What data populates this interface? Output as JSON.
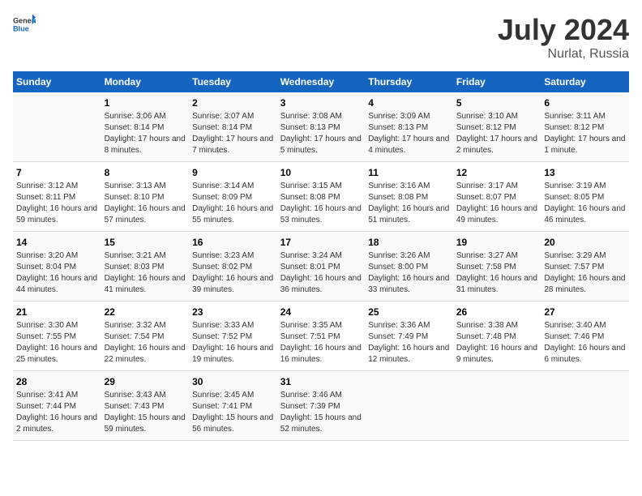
{
  "header": {
    "logo_general": "General",
    "logo_blue": "Blue",
    "title": "July 2024",
    "subtitle": "Nurlat, Russia"
  },
  "calendar": {
    "days_of_week": [
      "Sunday",
      "Monday",
      "Tuesday",
      "Wednesday",
      "Thursday",
      "Friday",
      "Saturday"
    ],
    "weeks": [
      [
        {
          "day": "",
          "sunrise": "",
          "sunset": "",
          "daylight": ""
        },
        {
          "day": "1",
          "sunrise": "Sunrise: 3:06 AM",
          "sunset": "Sunset: 8:14 PM",
          "daylight": "Daylight: 17 hours and 8 minutes."
        },
        {
          "day": "2",
          "sunrise": "Sunrise: 3:07 AM",
          "sunset": "Sunset: 8:14 PM",
          "daylight": "Daylight: 17 hours and 7 minutes."
        },
        {
          "day": "3",
          "sunrise": "Sunrise: 3:08 AM",
          "sunset": "Sunset: 8:13 PM",
          "daylight": "Daylight: 17 hours and 5 minutes."
        },
        {
          "day": "4",
          "sunrise": "Sunrise: 3:09 AM",
          "sunset": "Sunset: 8:13 PM",
          "daylight": "Daylight: 17 hours and 4 minutes."
        },
        {
          "day": "5",
          "sunrise": "Sunrise: 3:10 AM",
          "sunset": "Sunset: 8:12 PM",
          "daylight": "Daylight: 17 hours and 2 minutes."
        },
        {
          "day": "6",
          "sunrise": "Sunrise: 3:11 AM",
          "sunset": "Sunset: 8:12 PM",
          "daylight": "Daylight: 17 hours and 1 minute."
        }
      ],
      [
        {
          "day": "7",
          "sunrise": "Sunrise: 3:12 AM",
          "sunset": "Sunset: 8:11 PM",
          "daylight": "Daylight: 16 hours and 59 minutes."
        },
        {
          "day": "8",
          "sunrise": "Sunrise: 3:13 AM",
          "sunset": "Sunset: 8:10 PM",
          "daylight": "Daylight: 16 hours and 57 minutes."
        },
        {
          "day": "9",
          "sunrise": "Sunrise: 3:14 AM",
          "sunset": "Sunset: 8:09 PM",
          "daylight": "Daylight: 16 hours and 55 minutes."
        },
        {
          "day": "10",
          "sunrise": "Sunrise: 3:15 AM",
          "sunset": "Sunset: 8:08 PM",
          "daylight": "Daylight: 16 hours and 53 minutes."
        },
        {
          "day": "11",
          "sunrise": "Sunrise: 3:16 AM",
          "sunset": "Sunset: 8:08 PM",
          "daylight": "Daylight: 16 hours and 51 minutes."
        },
        {
          "day": "12",
          "sunrise": "Sunrise: 3:17 AM",
          "sunset": "Sunset: 8:07 PM",
          "daylight": "Daylight: 16 hours and 49 minutes."
        },
        {
          "day": "13",
          "sunrise": "Sunrise: 3:19 AM",
          "sunset": "Sunset: 8:05 PM",
          "daylight": "Daylight: 16 hours and 46 minutes."
        }
      ],
      [
        {
          "day": "14",
          "sunrise": "Sunrise: 3:20 AM",
          "sunset": "Sunset: 8:04 PM",
          "daylight": "Daylight: 16 hours and 44 minutes."
        },
        {
          "day": "15",
          "sunrise": "Sunrise: 3:21 AM",
          "sunset": "Sunset: 8:03 PM",
          "daylight": "Daylight: 16 hours and 41 minutes."
        },
        {
          "day": "16",
          "sunrise": "Sunrise: 3:23 AM",
          "sunset": "Sunset: 8:02 PM",
          "daylight": "Daylight: 16 hours and 39 minutes."
        },
        {
          "day": "17",
          "sunrise": "Sunrise: 3:24 AM",
          "sunset": "Sunset: 8:01 PM",
          "daylight": "Daylight: 16 hours and 36 minutes."
        },
        {
          "day": "18",
          "sunrise": "Sunrise: 3:26 AM",
          "sunset": "Sunset: 8:00 PM",
          "daylight": "Daylight: 16 hours and 33 minutes."
        },
        {
          "day": "19",
          "sunrise": "Sunrise: 3:27 AM",
          "sunset": "Sunset: 7:58 PM",
          "daylight": "Daylight: 16 hours and 31 minutes."
        },
        {
          "day": "20",
          "sunrise": "Sunrise: 3:29 AM",
          "sunset": "Sunset: 7:57 PM",
          "daylight": "Daylight: 16 hours and 28 minutes."
        }
      ],
      [
        {
          "day": "21",
          "sunrise": "Sunrise: 3:30 AM",
          "sunset": "Sunset: 7:55 PM",
          "daylight": "Daylight: 16 hours and 25 minutes."
        },
        {
          "day": "22",
          "sunrise": "Sunrise: 3:32 AM",
          "sunset": "Sunset: 7:54 PM",
          "daylight": "Daylight: 16 hours and 22 minutes."
        },
        {
          "day": "23",
          "sunrise": "Sunrise: 3:33 AM",
          "sunset": "Sunset: 7:52 PM",
          "daylight": "Daylight: 16 hours and 19 minutes."
        },
        {
          "day": "24",
          "sunrise": "Sunrise: 3:35 AM",
          "sunset": "Sunset: 7:51 PM",
          "daylight": "Daylight: 16 hours and 16 minutes."
        },
        {
          "day": "25",
          "sunrise": "Sunrise: 3:36 AM",
          "sunset": "Sunset: 7:49 PM",
          "daylight": "Daylight: 16 hours and 12 minutes."
        },
        {
          "day": "26",
          "sunrise": "Sunrise: 3:38 AM",
          "sunset": "Sunset: 7:48 PM",
          "daylight": "Daylight: 16 hours and 9 minutes."
        },
        {
          "day": "27",
          "sunrise": "Sunrise: 3:40 AM",
          "sunset": "Sunset: 7:46 PM",
          "daylight": "Daylight: 16 hours and 6 minutes."
        }
      ],
      [
        {
          "day": "28",
          "sunrise": "Sunrise: 3:41 AM",
          "sunset": "Sunset: 7:44 PM",
          "daylight": "Daylight: 16 hours and 2 minutes."
        },
        {
          "day": "29",
          "sunrise": "Sunrise: 3:43 AM",
          "sunset": "Sunset: 7:43 PM",
          "daylight": "Daylight: 15 hours and 59 minutes."
        },
        {
          "day": "30",
          "sunrise": "Sunrise: 3:45 AM",
          "sunset": "Sunset: 7:41 PM",
          "daylight": "Daylight: 15 hours and 56 minutes."
        },
        {
          "day": "31",
          "sunrise": "Sunrise: 3:46 AM",
          "sunset": "Sunset: 7:39 PM",
          "daylight": "Daylight: 15 hours and 52 minutes."
        },
        {
          "day": "",
          "sunrise": "",
          "sunset": "",
          "daylight": ""
        },
        {
          "day": "",
          "sunrise": "",
          "sunset": "",
          "daylight": ""
        },
        {
          "day": "",
          "sunrise": "",
          "sunset": "",
          "daylight": ""
        }
      ]
    ]
  }
}
